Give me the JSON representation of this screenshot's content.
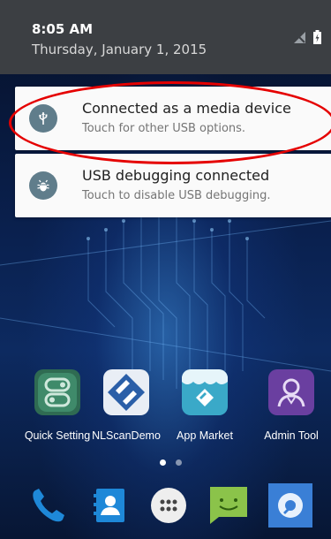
{
  "status": {
    "time": "8:05 AM",
    "date": "Thursday, January 1, 2015"
  },
  "notifications": [
    {
      "title": "Connected as a media device",
      "subtitle": "Touch for other USB options.",
      "icon": "usb-icon"
    },
    {
      "title": "USB debugging connected",
      "subtitle": "Touch to disable USB debugging.",
      "icon": "android-bug-icon"
    }
  ],
  "apps": [
    {
      "label": "Quick Setting",
      "icon": "quick-setting-icon"
    },
    {
      "label": "NLScanDemo",
      "icon": "nlscan-demo-icon"
    },
    {
      "label": "App Market",
      "icon": "app-market-icon"
    },
    {
      "label": "Admin Tool",
      "icon": "admin-tool-icon"
    }
  ],
  "dock": [
    "phone-icon",
    "contacts-icon",
    "app-drawer-icon",
    "messaging-icon",
    "browser-icon"
  ],
  "colors": {
    "shade": "#3c3f43",
    "card": "#fafafa",
    "notif_icon_bg": "#607d8b",
    "highlight": "#e50000"
  }
}
